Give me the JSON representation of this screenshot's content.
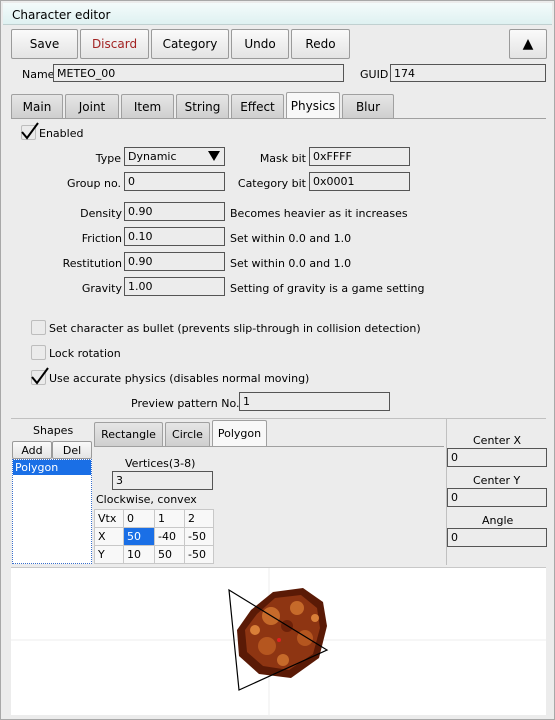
{
  "window": {
    "title": "Character editor"
  },
  "toolbar": {
    "save": "Save",
    "discard": "Discard",
    "category": "Category",
    "undo": "Undo",
    "redo": "Redo",
    "up": "▲",
    "discard_color": "#a22222"
  },
  "header": {
    "name_label": "Name",
    "name_value": "METEO_00",
    "guid_label": "GUID",
    "guid_value": "174"
  },
  "tabs": [
    "Main",
    "Joint",
    "Item",
    "String",
    "Effect",
    "Physics",
    "Blur"
  ],
  "active_tab": "Physics",
  "physics": {
    "enabled_label": "Enabled",
    "enabled": true,
    "type_label": "Type",
    "type_value": "Dynamic",
    "mask_label": "Mask bit",
    "mask_value": "0xFFFF",
    "group_label": "Group no.",
    "group_value": "0",
    "category_label": "Category bit",
    "category_value": "0x0001",
    "density_label": "Density",
    "density_value": "0.90",
    "density_hint": "Becomes heavier as it increases",
    "friction_label": "Friction",
    "friction_value": "0.10",
    "friction_hint": "Set within 0.0 and 1.0",
    "restitution_label": "Restitution",
    "restitution_value": "0.90",
    "restitution_hint": "Set within 0.0 and 1.0",
    "gravity_label": "Gravity",
    "gravity_value": "1.00",
    "gravity_hint": "Setting of gravity is a game setting",
    "bullet_label": "Set character as bullet (prevents slip-through in collision detection)",
    "bullet": false,
    "lock_label": "Lock rotation",
    "lock": false,
    "accurate_label": "Use accurate physics (disables normal moving)",
    "accurate": true,
    "preview_label": "Preview pattern No.",
    "preview_value": "1"
  },
  "shapes": {
    "title": "Shapes",
    "add": "Add",
    "del": "Del",
    "items": [
      "Polygon"
    ],
    "shape_tabs": [
      "Rectangle",
      "Circle",
      "Polygon"
    ],
    "active_shape_tab": "Polygon",
    "vertices_label": "Vertices(3-8)",
    "vertices_value": "3",
    "winding_note": "Clockwise, convex",
    "table": {
      "header": [
        "Vtx",
        "0",
        "1",
        "2"
      ],
      "rows": [
        [
          "X",
          "50",
          "-40",
          "-50"
        ],
        [
          "Y",
          "10",
          "50",
          "-50"
        ]
      ]
    },
    "center_x_label": "Center X",
    "center_x_value": "0",
    "center_y_label": "Center Y",
    "center_y_value": "0",
    "angle_label": "Angle",
    "angle_value": "0"
  },
  "preview": {
    "sprite": "meteor-rock",
    "colors": {
      "rock_dark": "#5a1a06",
      "rock_mid": "#8e3512",
      "rock_light": "#c66a2a",
      "outline": "#000000",
      "center": "#e02020"
    }
  }
}
